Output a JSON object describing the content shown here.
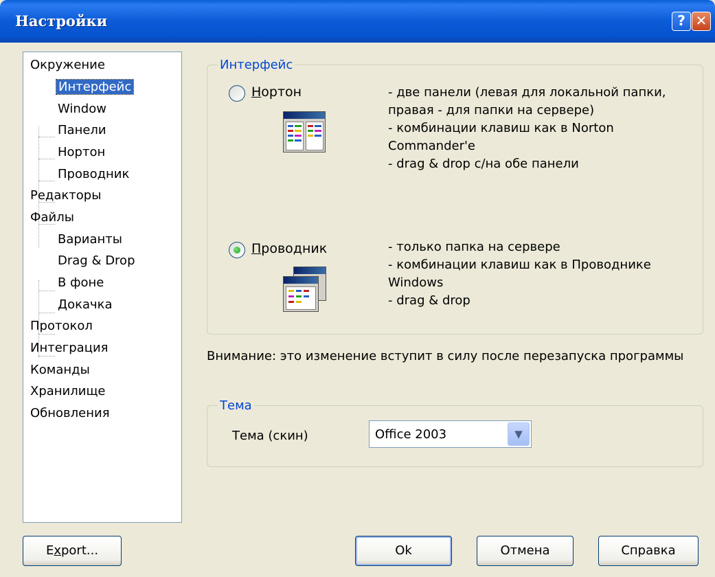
{
  "window": {
    "title": "Настройки",
    "help_button": "?",
    "close_button": "✕"
  },
  "tree": {
    "items": [
      {
        "label": "Окружение",
        "level": 0
      },
      {
        "label": "Интерфейс",
        "level": 1,
        "selected": true
      },
      {
        "label": "Window",
        "level": 1
      },
      {
        "label": "Панели",
        "level": 1
      },
      {
        "label": "Нортон",
        "level": 1
      },
      {
        "label": "Проводник",
        "level": 1
      },
      {
        "label": "Редакторы",
        "level": 0
      },
      {
        "label": "Файлы",
        "level": 0
      },
      {
        "label": "Варианты",
        "level": 1
      },
      {
        "label": "Drag & Drop",
        "level": 1
      },
      {
        "label": "В фоне",
        "level": 1
      },
      {
        "label": "Докачка",
        "level": 1
      },
      {
        "label": "Протокол",
        "level": 0
      },
      {
        "label": "Интеграция",
        "level": 0
      },
      {
        "label": "Команды",
        "level": 0
      },
      {
        "label": "Хранилище",
        "level": 0
      },
      {
        "label": "Обновления",
        "level": 0
      }
    ]
  },
  "interface_group": {
    "legend": "Интерфейс",
    "norton": {
      "label_first": "Н",
      "label_rest": "ортон",
      "checked": false,
      "description": "- две панели (левая для локальной папки,\nправая - для папки на сервере)\n- комбинации клавиш как в Norton\nCommander'e\n- drag & drop с/на обе панели"
    },
    "explorer": {
      "label_first": "П",
      "label_rest": "роводник",
      "checked": true,
      "description": "- только папка на сервере\n- комбинации клавиш как в Проводнике\nWindows\n- drag & drop"
    }
  },
  "warning": "Внимание: это изменение вступит в силу после перезапуска программы",
  "theme_group": {
    "legend": "Тема",
    "label": "Тема (скин)",
    "value": "Office 2003"
  },
  "buttons": {
    "export_first": "E",
    "export_mid": "x",
    "export_rest": "port...",
    "ok": "Ok",
    "cancel": "Отмена",
    "help": "Справка"
  },
  "colors": {
    "titlebar": "#0a5fd6",
    "selection": "#316ac5",
    "group_legend": "#0046d5",
    "dialog_bg": "#ece9d8"
  }
}
